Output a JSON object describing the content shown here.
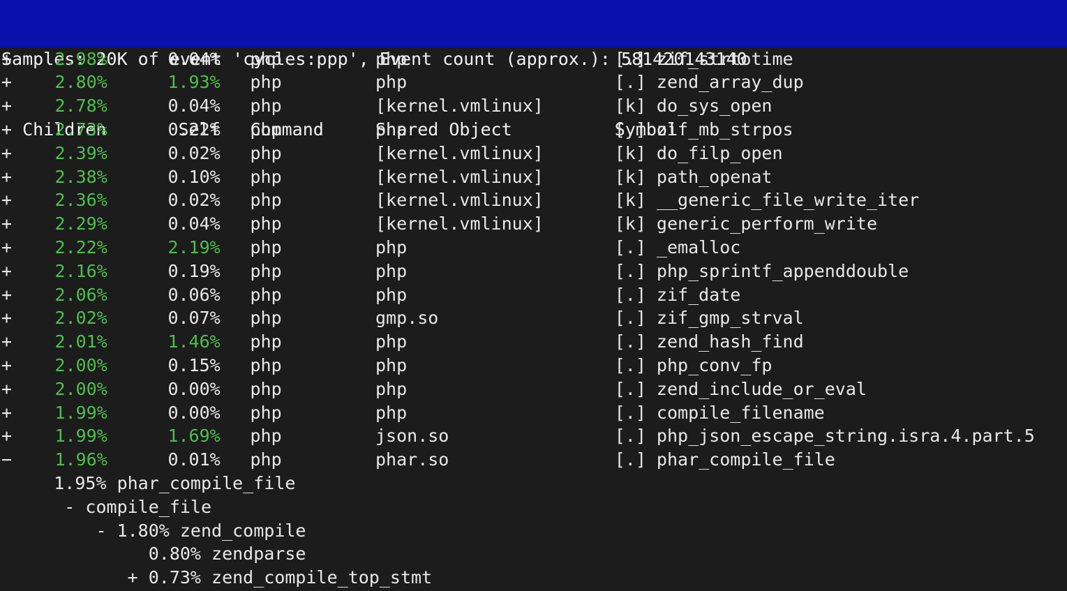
{
  "terminal": {
    "background": "#1c1c1c",
    "header_background": "#0a10ab",
    "header_foreground": "#f2f2f2",
    "accent_green": "#4ebe4e",
    "foreground": "#e8e8e8",
    "cols": 93,
    "rows": 25
  },
  "header": {
    "status_line": "Samples: 20K of event 'cycles:ppp', Event count (approx.): 581420143140",
    "samples": "20K",
    "event": "cycles:ppp",
    "event_count": "581420143140",
    "columns": {
      "children": "Children",
      "self": "Self",
      "command": "Command",
      "shared_object": "Shared Object",
      "symbol": "Symbol"
    },
    "column_line": "  Children      Self  Command  Shared Object      Symbol"
  },
  "table": {
    "rows": [
      {
        "marker": "+",
        "children": "2.98%",
        "self": "0.04%",
        "self_green": false,
        "command": "php",
        "shared_object": "php",
        "symbol_kind": "[.]",
        "symbol": "zif_strtotime"
      },
      {
        "marker": "+",
        "children": "2.80%",
        "self": "1.93%",
        "self_green": true,
        "command": "php",
        "shared_object": "php",
        "symbol_kind": "[.]",
        "symbol": "zend_array_dup"
      },
      {
        "marker": "+",
        "children": "2.78%",
        "self": "0.04%",
        "self_green": false,
        "command": "php",
        "shared_object": "[kernel.vmlinux]",
        "symbol_kind": "[k]",
        "symbol": "do_sys_open"
      },
      {
        "marker": "+",
        "children": "2.73%",
        "self": "0.22%",
        "self_green": false,
        "command": "php",
        "shared_object": "php",
        "symbol_kind": "[.]",
        "symbol": "zif_mb_strpos"
      },
      {
        "marker": "+",
        "children": "2.39%",
        "self": "0.02%",
        "self_green": false,
        "command": "php",
        "shared_object": "[kernel.vmlinux]",
        "symbol_kind": "[k]",
        "symbol": "do_filp_open"
      },
      {
        "marker": "+",
        "children": "2.38%",
        "self": "0.10%",
        "self_green": false,
        "command": "php",
        "shared_object": "[kernel.vmlinux]",
        "symbol_kind": "[k]",
        "symbol": "path_openat"
      },
      {
        "marker": "+",
        "children": "2.36%",
        "self": "0.02%",
        "self_green": false,
        "command": "php",
        "shared_object": "[kernel.vmlinux]",
        "symbol_kind": "[k]",
        "symbol": "__generic_file_write_iter"
      },
      {
        "marker": "+",
        "children": "2.29%",
        "self": "0.04%",
        "self_green": false,
        "command": "php",
        "shared_object": "[kernel.vmlinux]",
        "symbol_kind": "[k]",
        "symbol": "generic_perform_write"
      },
      {
        "marker": "+",
        "children": "2.22%",
        "self": "2.19%",
        "self_green": true,
        "command": "php",
        "shared_object": "php",
        "symbol_kind": "[.]",
        "symbol": "_emalloc"
      },
      {
        "marker": "+",
        "children": "2.16%",
        "self": "0.19%",
        "self_green": false,
        "command": "php",
        "shared_object": "php",
        "symbol_kind": "[.]",
        "symbol": "php_sprintf_appenddouble"
      },
      {
        "marker": "+",
        "children": "2.06%",
        "self": "0.06%",
        "self_green": false,
        "command": "php",
        "shared_object": "php",
        "symbol_kind": "[.]",
        "symbol": "zif_date"
      },
      {
        "marker": "+",
        "children": "2.02%",
        "self": "0.07%",
        "self_green": false,
        "command": "php",
        "shared_object": "gmp.so",
        "symbol_kind": "[.]",
        "symbol": "zif_gmp_strval"
      },
      {
        "marker": "+",
        "children": "2.01%",
        "self": "1.46%",
        "self_green": true,
        "command": "php",
        "shared_object": "php",
        "symbol_kind": "[.]",
        "symbol": "zend_hash_find"
      },
      {
        "marker": "+",
        "children": "2.00%",
        "self": "0.15%",
        "self_green": false,
        "command": "php",
        "shared_object": "php",
        "symbol_kind": "[.]",
        "symbol": "php_conv_fp"
      },
      {
        "marker": "+",
        "children": "2.00%",
        "self": "0.00%",
        "self_green": false,
        "command": "php",
        "shared_object": "php",
        "symbol_kind": "[.]",
        "symbol": "zend_include_or_eval"
      },
      {
        "marker": "+",
        "children": "1.99%",
        "self": "0.00%",
        "self_green": false,
        "command": "php",
        "shared_object": "php",
        "symbol_kind": "[.]",
        "symbol": "compile_filename"
      },
      {
        "marker": "+",
        "children": "1.99%",
        "self": "1.69%",
        "self_green": true,
        "command": "php",
        "shared_object": "json.so",
        "symbol_kind": "[.]",
        "symbol": "php_json_escape_string.isra.4.part.5"
      },
      {
        "marker": "−",
        "children": "1.96%",
        "self": "0.01%",
        "self_green": false,
        "command": "php",
        "shared_object": "phar.so",
        "symbol_kind": "[.]",
        "symbol": "phar_compile_file"
      }
    ],
    "callchain": [
      {
        "indent": 5,
        "marker": "",
        "percent": "1.95%",
        "symbol": "phar_compile_file"
      },
      {
        "indent": 6,
        "marker": "-",
        "percent": "",
        "symbol": "compile_file"
      },
      {
        "indent": 9,
        "marker": "-",
        "percent": "1.80%",
        "symbol": "zend_compile"
      },
      {
        "indent": 14,
        "marker": "",
        "percent": "0.80%",
        "symbol": "zendparse"
      },
      {
        "indent": 12,
        "marker": "+",
        "percent": "0.73%",
        "symbol": "zend_compile_top_stmt"
      }
    ]
  }
}
